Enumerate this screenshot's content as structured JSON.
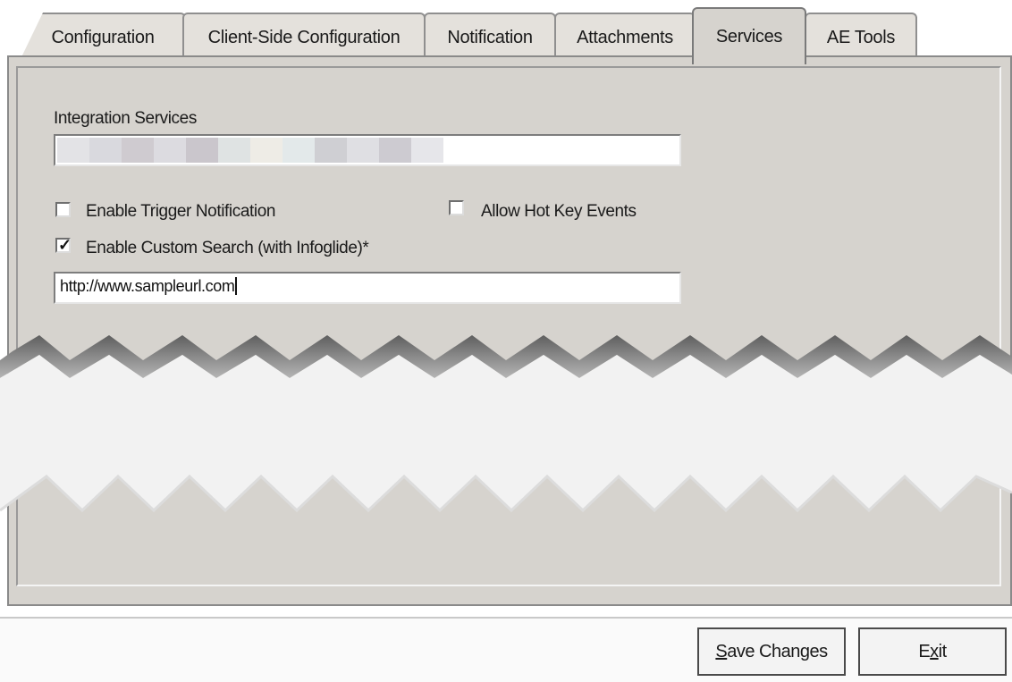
{
  "tabs": [
    {
      "label": "Configuration"
    },
    {
      "label": "Client-Side Configuration"
    },
    {
      "label": "Notification"
    },
    {
      "label": "Attachments"
    },
    {
      "label": "Services",
      "active": true
    },
    {
      "label": "AE Tools"
    }
  ],
  "services": {
    "integration_label": "Integration Services",
    "integration_value": "",
    "enable_trigger_label": "Enable Trigger Notification",
    "enable_trigger_checked": false,
    "allow_hotkey_label": "Allow Hot Key Events",
    "allow_hotkey_checked": false,
    "custom_search_label": "Enable Custom Search (with Infoglide)*",
    "custom_search_checked": true,
    "custom_search_url": "http://www.sampleurl.com"
  },
  "footer": {
    "save_mnemonic": "S",
    "save_rest": "ave Changes",
    "exit_before": "E",
    "exit_mnemonic": "x",
    "exit_after": "it"
  },
  "colors": {
    "panel": "#d6d3ce",
    "tab": "#e4e1dc",
    "tear_shadow": "#777777",
    "tear_fill": "#ececec"
  },
  "icons": {
    "checkbox_checked": "check-icon"
  }
}
